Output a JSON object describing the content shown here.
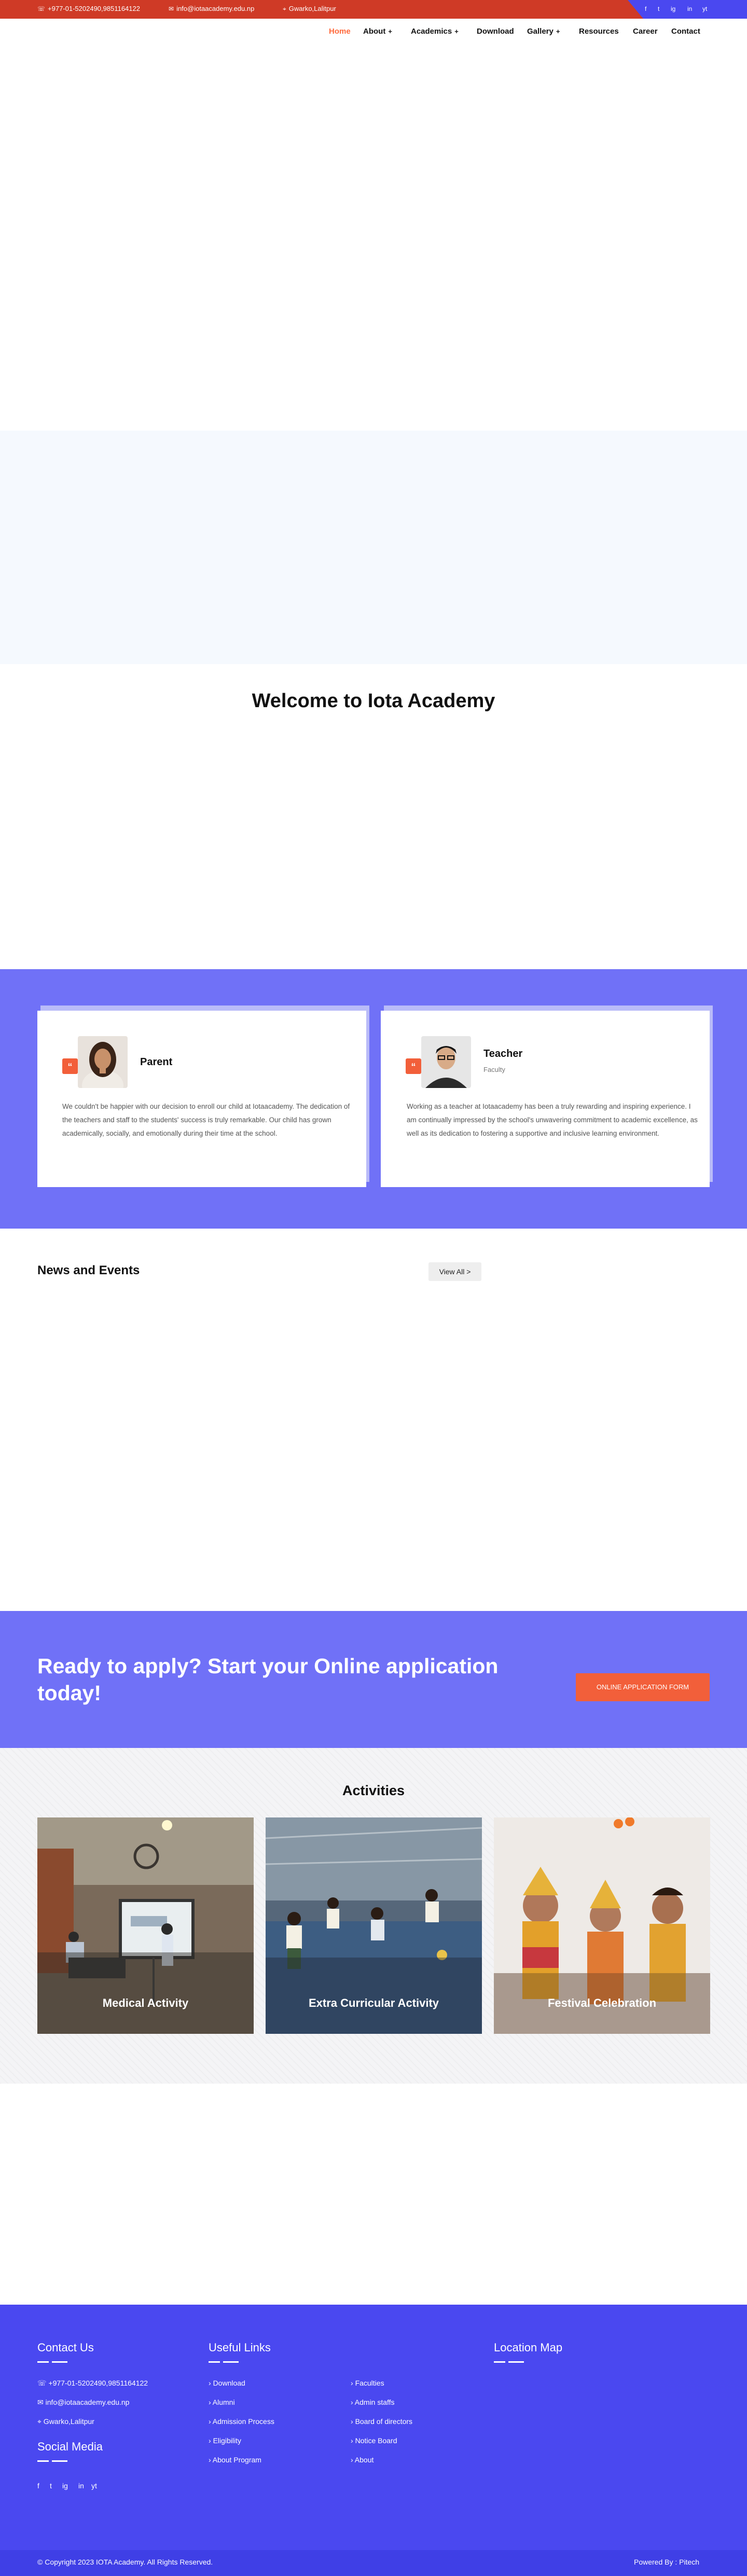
{
  "topbar": {
    "phone": "+977-01-5202490,9851164122",
    "email": "info@iotaacademy.edu.np",
    "address": "Gwarko,Lalitpur",
    "social": [
      "f",
      "t",
      "ig",
      "in",
      "yt"
    ]
  },
  "nav": {
    "items": [
      {
        "label": "Home",
        "active": true
      },
      {
        "label": "About",
        "dropdown": true
      },
      {
        "label": "Academics",
        "dropdown": true
      },
      {
        "label": "Download"
      },
      {
        "label": "Gallery",
        "dropdown": true
      },
      {
        "label": "Resources"
      },
      {
        "label": "Career"
      },
      {
        "label": "Contact"
      }
    ],
    "plus": "+"
  },
  "welcome": {
    "title": "Welcome to Iota Academy"
  },
  "testimonials": [
    {
      "name": "Parent",
      "role": "",
      "text": "We couldn't be happier with our decision to enroll our child at Iotaacademy. The dedication of the teachers and staff to the students' success is truly remarkable. Our child has grown academically, socially, and emotionally during their time at the school."
    },
    {
      "name": "Teacher",
      "role": "Faculty",
      "text": "Working as a teacher at Iotaacademy has been a truly rewarding and inspiring experience. I am continually impressed by the school's unwavering commitment to academic excellence, as well as its dedication to fostering a supportive and inclusive learning environment."
    }
  ],
  "quote_mark": "“",
  "news": {
    "title": "News and Events",
    "view_all": "View All >"
  },
  "apply": {
    "text": "Ready to apply? Start your Online application today!",
    "button": "ONLINE APPLICATION FORM"
  },
  "activities": {
    "title": "Activities",
    "items": [
      {
        "label": "Medical Activity"
      },
      {
        "label": "Extra Curricular Activity"
      },
      {
        "label": "Festival Celebration"
      }
    ]
  },
  "footer": {
    "contact_title": "Contact Us",
    "phone": "+977-01-5202490,9851164122",
    "email": "info@iotaacademy.edu.np",
    "address": "Gwarko,Lalitpur",
    "social_title": "Social Media",
    "useful_title": "Useful Links",
    "links_col1": [
      "Download",
      "Alumni",
      "Admission Process",
      "Eligibility",
      "About Program"
    ],
    "links_col2": [
      "Faculties",
      "Admin staffs",
      "Board of directors",
      "Notice Board",
      "About"
    ],
    "map_title": "Location Map",
    "copyright": "© Copyright 2023 IOTA Academy. All Rights Reserved.",
    "powered": "Powered By : Pitech"
  },
  "colors": {
    "accent": "#f25f3a",
    "brand_blue": "#4a48f0",
    "band": "#7071f7",
    "topbar_red": "#cf3a26"
  }
}
